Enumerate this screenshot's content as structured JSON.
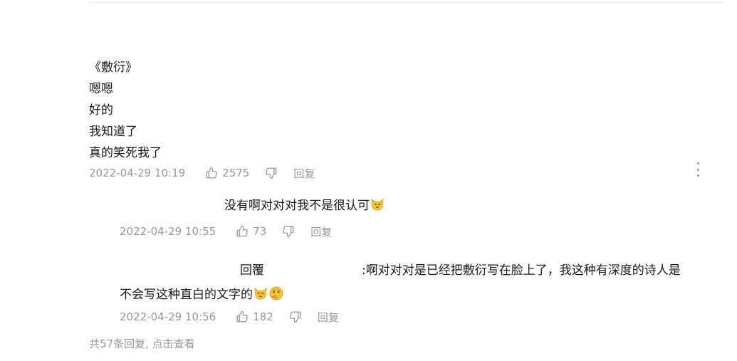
{
  "comment": {
    "lines": [
      "《敷衍》",
      "嗯嗯",
      "好的",
      "我知道了",
      "真的笑死我了"
    ],
    "time": "2022-04-29 10:19",
    "likes": "2575",
    "reply_label": "回复"
  },
  "replies": [
    {
      "text": "没有啊对对对我不是很认可",
      "emojis": [
        "cat-face-emoji"
      ],
      "time": "2022-04-29 10:55",
      "likes": "73",
      "reply_label": "回复"
    },
    {
      "reply_prefix": "回覆",
      "text_line1": ":啊对对对是已经把敷衍写在脸上了，我这种有深度的诗人是",
      "text_line2": "不会写这种直白的文字的",
      "emojis": [
        "cat-face-emoji",
        "thinking-face-emoji"
      ],
      "time": "2022-04-29 10:56",
      "likes": "182",
      "reply_label": "回复"
    }
  ],
  "footer": {
    "view_all": "共57条回复, 点击查看"
  },
  "colors": {
    "text": "#18191c",
    "meta": "#9499a0",
    "emoji": "#f5c33b"
  }
}
